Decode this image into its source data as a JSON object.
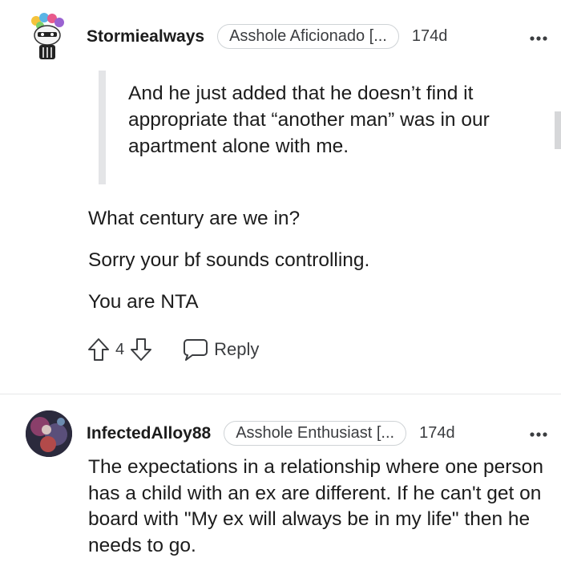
{
  "comments": [
    {
      "username": "Stormiealways",
      "flair": "Asshole Aficionado [...",
      "age": "174d",
      "quote": "And he just added that he doesn’t find it appropriate that “another man” was in our apartment alone with me.",
      "lines": [
        "What century are we in?",
        "Sorry your bf sounds controlling.",
        "You are NTA"
      ],
      "votes": "4",
      "reply_label": "Reply"
    },
    {
      "username": "InfectedAlloy88",
      "flair": "Asshole Enthusiast [...",
      "age": "174d",
      "text": "The expectations in a relationship where one person has a child with an ex are different. If he can't get on board with \"My ex will always be in my life\" then he needs to go."
    }
  ],
  "icons": {
    "upvote": "arrow-up-outline-icon",
    "downvote": "arrow-down-outline-icon",
    "reply": "speech-bubble-icon",
    "more": "ellipsis-icon"
  },
  "colors": {
    "text": "#1c1c1c",
    "meta": "#3b3d40",
    "quote_bar": "#e4e5e7"
  }
}
